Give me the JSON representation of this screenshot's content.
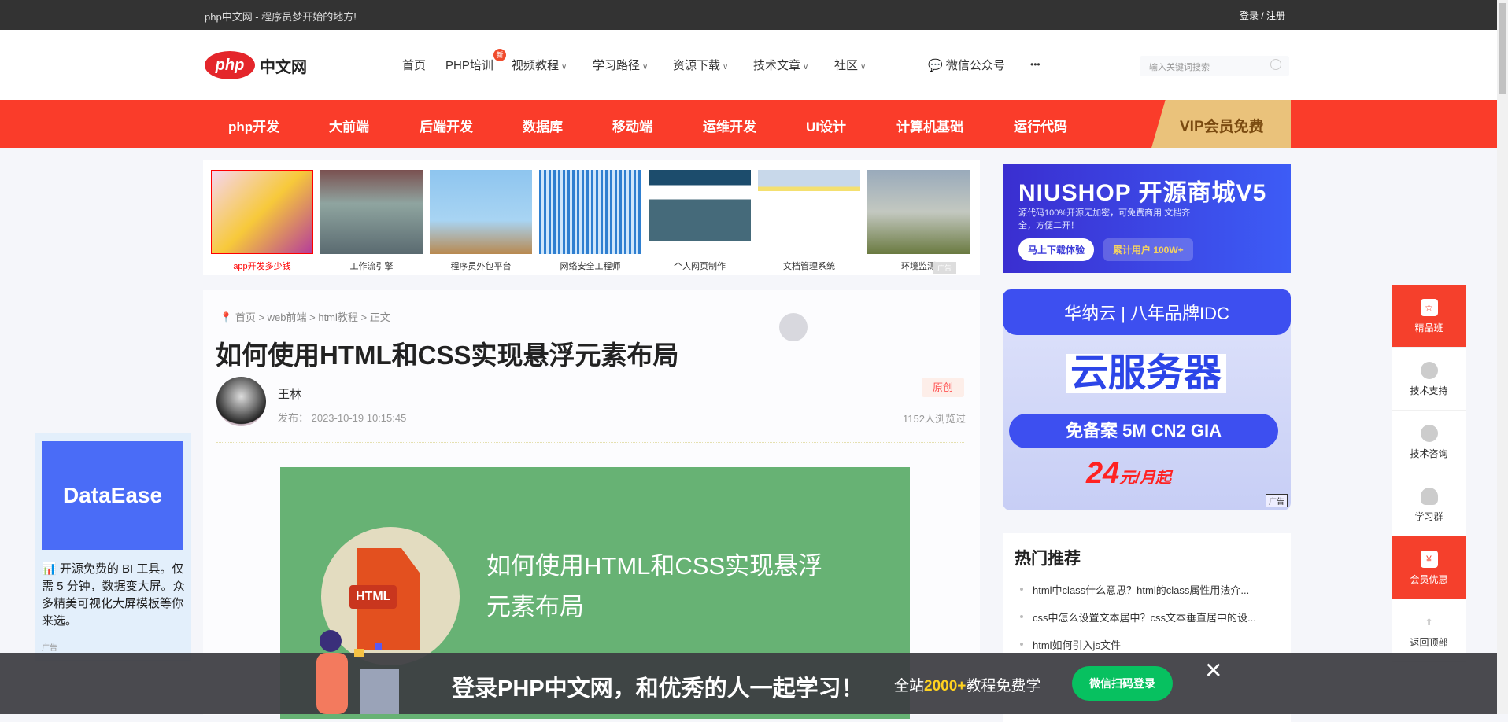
{
  "topbar": {
    "slogan": "php中文网 - 程序员梦开始的地方!",
    "login": "登录",
    "sep": "/",
    "register": "注册"
  },
  "header": {
    "logo_php": "php",
    "logo_cn": "中文网",
    "nav": [
      "首页",
      "PHP培训",
      "视频教程",
      "学习路径",
      "资源下载",
      "技术文章",
      "社区"
    ],
    "new_badge": "新",
    "wechat": "微信公众号",
    "more": "•••",
    "search_placeholder": "输入关键词搜索"
  },
  "categories": [
    "php开发",
    "大前端",
    "后端开发",
    "数据库",
    "移动端",
    "运维开发",
    "UI设计",
    "计算机基础",
    "运行代码"
  ],
  "vip": "VIP会员免费",
  "thumbs": [
    "app开发多少钱",
    "工作流引擎",
    "程序员外包平台",
    "网络安全工程师",
    "个人网页制作",
    "文档管理系统",
    "环境监测"
  ],
  "thumb_ad": "广告",
  "article": {
    "breadcrumb": [
      "首页",
      "web前端",
      "html教程",
      "正文"
    ],
    "title": "如何使用HTML和CSS实现悬浮元素布局",
    "author": "王林",
    "date": "发布： 2023-10-19 10:15:45",
    "badge": "原创",
    "views": "1152人浏览过",
    "hero_text": "如何使用HTML和CSS实现悬浮元素布局",
    "hero_file": "HTML"
  },
  "left_ad": {
    "brand": "DataEase",
    "text": "📊 开源免费的 BI 工具。仅需 5 分钟，数据变大屏。众多精美可视化大屏模板等你来选。",
    "ad": "广告"
  },
  "niushop": {
    "title": "NIUSHOP 开源商城V5",
    "sub": "源代码100%开源无加密，可免费商用 文档齐全，方便二开！",
    "btn": "马上下载体验",
    "users": "累计用户 100W+"
  },
  "hncloud": {
    "brand": "华纳云 | 八年品牌IDC",
    "big": "云服务器",
    "pill": "免备案  5M CN2 GIA",
    "price": "24",
    "unit": "元/月起",
    "ad": "广告"
  },
  "hot": {
    "title": "热门推荐",
    "items": [
      "html中class什么意思？html的class属性用法介...",
      "css中怎么设置文本居中？css文本垂直居中的设...",
      "html如何引入js文件"
    ]
  },
  "float_side": [
    "精品班",
    "技术支持",
    "技术咨询",
    "学习群",
    "会员优惠",
    "返回顶部"
  ],
  "bottom": {
    "headline": "登录PHP中文网，和优秀的人一起学习！",
    "sub_pre": "全站",
    "sub_num": "2000+",
    "sub_post": "教程免费学",
    "btn": "微信扫码登录",
    "close": "✕"
  }
}
